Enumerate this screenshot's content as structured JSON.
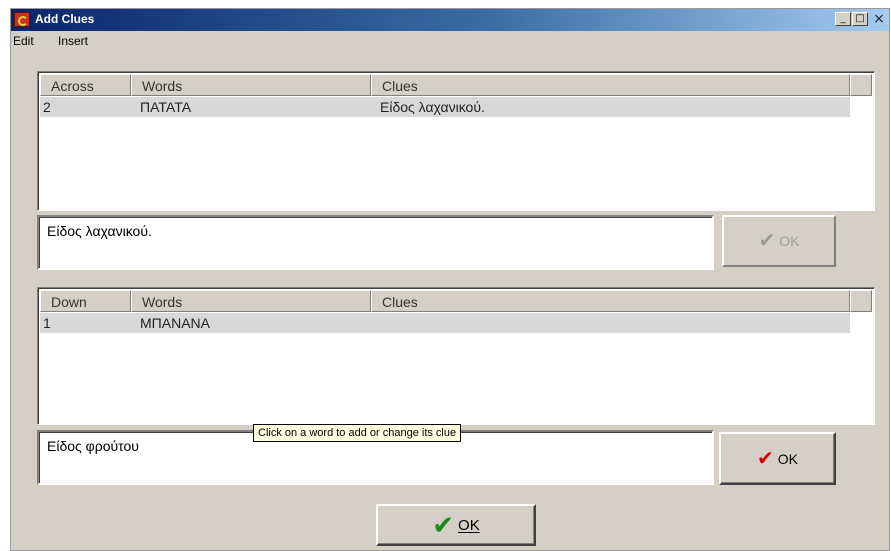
{
  "window": {
    "title": "Add Clues",
    "minimize_glyph": "_",
    "maximize_glyph": "□",
    "close_glyph": "×"
  },
  "menu": [
    {
      "label": "Edit"
    },
    {
      "label": "Insert"
    }
  ],
  "across": {
    "columns": [
      "Across",
      "Words",
      "Clues"
    ],
    "rows": [
      {
        "number": "2",
        "word": "ΠΑΤΑΤΑ",
        "clue": "Είδος λαχανικού."
      }
    ],
    "clue_text": "Είδος λαχανικού.",
    "ok_label": "OK",
    "ok_enabled": false
  },
  "down": {
    "columns": [
      "Down",
      "Words",
      "Clues"
    ],
    "rows": [
      {
        "number": "1",
        "word": "ΜΠΑΝΑΝΑ",
        "clue": ""
      }
    ],
    "clue_text": "Είδος φρούτου",
    "ok_label": "OK",
    "ok_enabled": true
  },
  "tooltip": "Click on a word to add or change its clue",
  "main_ok_label": "OK",
  "colors": {
    "titlebar_start": "#0a246a",
    "titlebar_end": "#a6caf0",
    "face": "#d4d0c8",
    "tooltip_bg": "#ffffe1",
    "check_red": "#d40000",
    "check_green": "#1a8a1a"
  },
  "icons": {
    "app": "crossword-app-icon",
    "check": "checkmark-icon"
  }
}
